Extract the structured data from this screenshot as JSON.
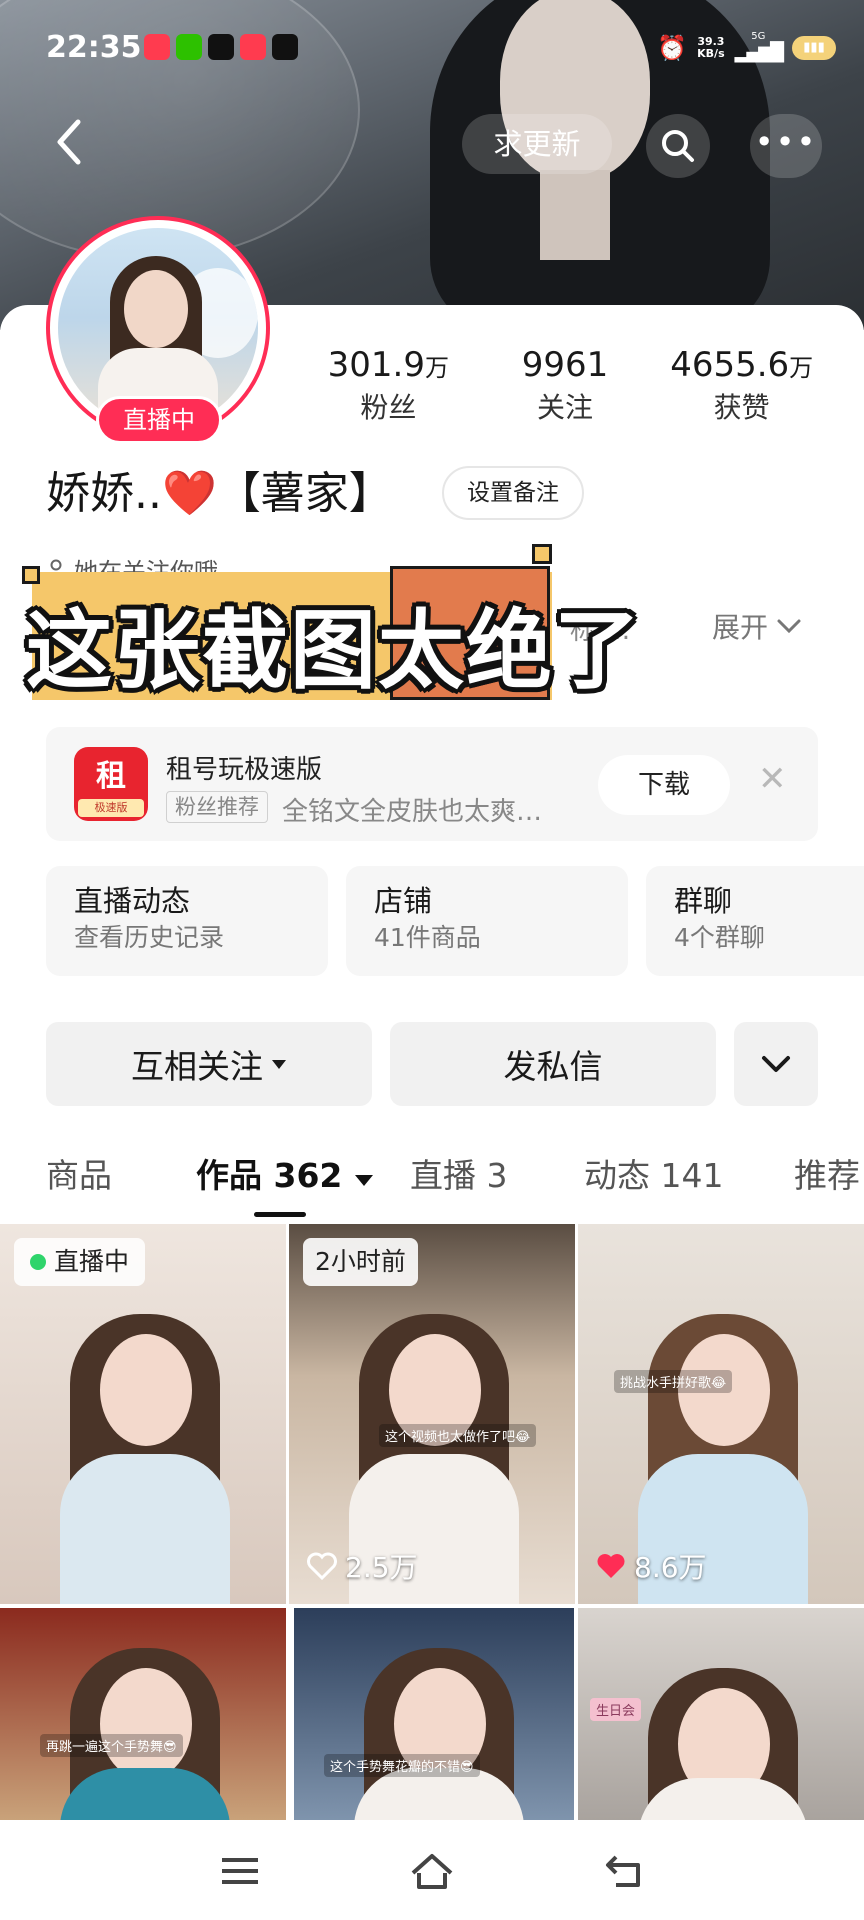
{
  "status_bar": {
    "time": "22:35",
    "net_speed_value": "39.3",
    "net_speed_unit": "KB/s",
    "network": "5G"
  },
  "nav": {
    "update_label": "求更新"
  },
  "profile": {
    "live_badge": "直播中",
    "stats": [
      {
        "value": "301.9",
        "unit": "万",
        "label": "粉丝"
      },
      {
        "value": "9961",
        "unit": "",
        "label": "关注"
      },
      {
        "value": "4655.6",
        "unit": "万",
        "label": "获赞"
      }
    ],
    "nickname": "娇娇..❤️【薯家】",
    "remark_button": "设置备注",
    "follow_hint": "她在关注你哦",
    "tag_peek": "标 …",
    "expand_label": "展开"
  },
  "overlay_caption": "这张截图太绝了",
  "ad": {
    "icon_char": "租",
    "icon_banner": "极速版",
    "title": "租号玩极速版",
    "tag": "粉丝推荐",
    "description": "全铭文全皮肤也太爽…",
    "download_label": "下载",
    "close_icon": "✕"
  },
  "features": [
    {
      "title": "直播动态",
      "subtitle": "查看历史记录"
    },
    {
      "title": "店铺",
      "subtitle": "41件商品"
    },
    {
      "title": "群聊",
      "subtitle": "4个群聊"
    }
  ],
  "actions": {
    "mutual_follow": "互相关注",
    "message": "发私信"
  },
  "tabs": [
    {
      "label": "商品"
    },
    {
      "label": "作品 362"
    },
    {
      "label": "直播 3"
    },
    {
      "label": "动态 141"
    },
    {
      "label": "推荐"
    }
  ],
  "videos": [
    {
      "badge": "直播中",
      "likes": "",
      "caption": ""
    },
    {
      "badge": "2小时前",
      "likes": "2.5万",
      "caption": "这个视频也太做作了吧😂"
    },
    {
      "badge": "",
      "likes": "8.6万",
      "caption": "挑战水手拼好歌😂"
    },
    {
      "badge": "",
      "likes": "",
      "caption": "再跳一遍这个手势舞😎"
    },
    {
      "badge": "",
      "likes": "",
      "caption": "这个手势舞花瓣的不错😎"
    },
    {
      "badge": "",
      "likes": "",
      "caption": "生日会"
    }
  ],
  "colors": {
    "accent": "#ff2d55",
    "live_dot": "#2fd46b",
    "caption_yellow": "#f5c76a",
    "caption_orange": "#e27b4d"
  }
}
